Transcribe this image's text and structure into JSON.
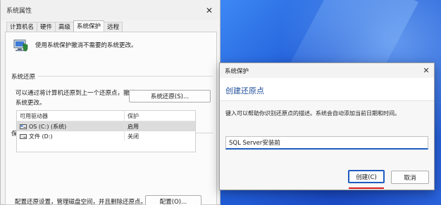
{
  "main_window": {
    "title": "系统属性",
    "close_glyph": "✕",
    "tabs": [
      {
        "label": "计算机名"
      },
      {
        "label": "硬件"
      },
      {
        "label": "高级"
      },
      {
        "label": "系统保护"
      },
      {
        "label": "远程"
      }
    ],
    "description": "使用系统保护撤消不需要的系统更改。",
    "restore_section": {
      "title": "系统还原",
      "text_line1": "可以通过将计算机还原到上一个还原点，撤消",
      "text_line2": "系统更改。",
      "button_label": "系统还原(S)..."
    },
    "protection_section": {
      "title": "保护设置",
      "columns": [
        "可用驱动器",
        "保护"
      ],
      "rows": [
        {
          "drive": "OS (C:) (系统)",
          "status": "启用"
        },
        {
          "drive": "文件 (D:)",
          "status": "关闭"
        }
      ],
      "configure_text": "配置还原设置，管理磁盘空间，并且删除还原点。",
      "configure_button": "配置(O)..."
    }
  },
  "dialog": {
    "title": "系统保护",
    "close_glyph": "✕",
    "heading": "创建还原点",
    "description": "键入可以帮助你识别还原点的描述。系统会自动添加当前日期和时间。",
    "input_value": "SQL Server安装前",
    "create_button": "创建(C)",
    "cancel_button": "取消"
  },
  "colors": {
    "accent": "#1f5dc0",
    "heading_blue": "#1f4e9a",
    "highlight_red": "#d81818"
  },
  "icons": [
    "shield-computer-icon",
    "drive-icon",
    "close-icon"
  ]
}
